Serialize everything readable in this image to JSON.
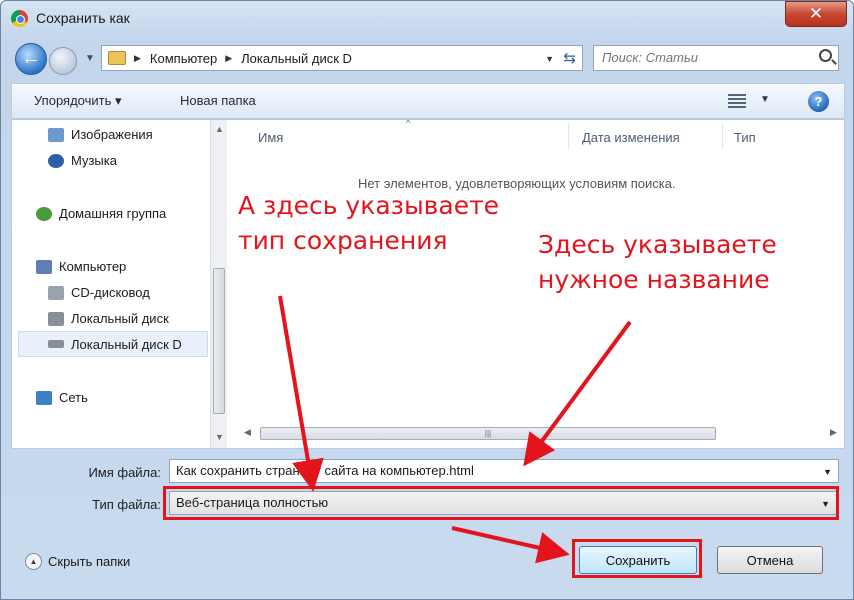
{
  "window": {
    "title": "Сохранить как",
    "close_label": "✕"
  },
  "nav": {
    "back_glyph": "←",
    "breadcrumbs": [
      "Компьютер",
      "Локальный диск D"
    ],
    "search_placeholder": "Поиск: Статьи"
  },
  "toolbar": {
    "organize_label": "Упорядочить ▾",
    "new_folder_label": "Новая папка",
    "help_glyph": "?"
  },
  "sidebar": {
    "items": [
      {
        "label": "Изображения",
        "icon": "pictures-icon",
        "color": "#6c9ad0"
      },
      {
        "label": "Музыка",
        "icon": "music-icon",
        "color": "#2c5fa8"
      },
      {
        "label": "Домашняя группа",
        "icon": "homegroup-icon",
        "color": "#4a9a3b"
      },
      {
        "label": "Компьютер",
        "icon": "computer-icon",
        "color": "#5d7fb3"
      },
      {
        "label": "CD-дисковод",
        "icon": "cd-drive-icon",
        "color": "#9aa3ad"
      },
      {
        "label": "Локальный диск",
        "icon": "local-disk-icon",
        "color": "#8a8f96"
      },
      {
        "label": "Локальный диск D",
        "icon": "local-disk-d-icon",
        "color": "#8a8f96"
      },
      {
        "label": "Сеть",
        "icon": "network-icon",
        "color": "#3c7fc4"
      }
    ]
  },
  "filelist": {
    "columns": [
      "Имя",
      "Дата изменения",
      "Тип"
    ],
    "empty_message": "Нет элементов, удовлетворяющих условиям поиска."
  },
  "form": {
    "filename_label": "Имя файла:",
    "filename_value": "Как сохранить страницу сайта на компьютер.html",
    "filetype_label": "Тип файла:",
    "filetype_value": "Веб-страница полностью"
  },
  "footer": {
    "hide_folders_label": "Скрыть папки",
    "save_label": "Сохранить",
    "cancel_label": "Отмена"
  },
  "annotations": {
    "type_note_line1": "А здесь указываете",
    "type_note_line2": "тип сохранения",
    "name_note_line1": "Здесь указываете",
    "name_note_line2": "нужное название",
    "color": "#e3141c"
  }
}
